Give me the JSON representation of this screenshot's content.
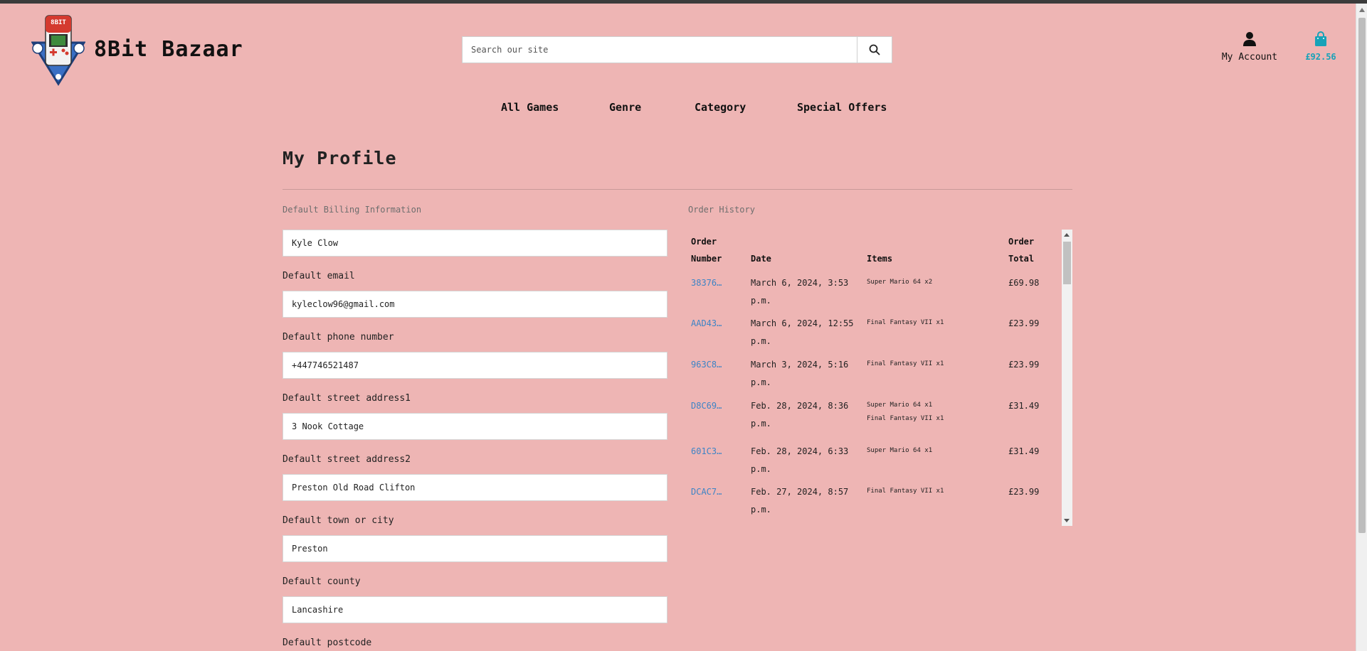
{
  "header": {
    "brand": "8Bit Bazaar",
    "logo_text": "8BIT",
    "search_placeholder": "Search our site",
    "account_label": "My Account",
    "cart_total": "£92.56"
  },
  "nav": [
    "All Games",
    "Genre",
    "Category",
    "Special Offers"
  ],
  "page_title": "My Profile",
  "billing": {
    "title": "Default Billing Information",
    "full_name": "Kyle Clow",
    "fields": [
      {
        "label": "Default email",
        "value": "kyleclow96@gmail.com"
      },
      {
        "label": "Default phone number",
        "value": "+447746521487"
      },
      {
        "label": "Default street address1",
        "value": "3 Nook Cottage"
      },
      {
        "label": "Default street address2",
        "value": "Preston Old Road Clifton"
      },
      {
        "label": "Default town or city",
        "value": "Preston"
      },
      {
        "label": "Default county",
        "value": "Lancashire"
      },
      {
        "label": "Default postcode",
        "value": ""
      }
    ]
  },
  "orders": {
    "title": "Order History",
    "headers": {
      "number_1": "Order",
      "number_2": "Number",
      "date": "Date",
      "items": "Items",
      "total_1": "Order",
      "total_2": "Total"
    },
    "rows": [
      {
        "number": "38376…",
        "date_1": "March 6, 2024, 3:53",
        "date_2": "p.m.",
        "items": [
          "Super Mario 64 x2"
        ],
        "total": "£69.98"
      },
      {
        "number": "AAD43…",
        "date_1": "March 6, 2024, 12:55",
        "date_2": "p.m.",
        "items": [
          "Final Fantasy VII x1"
        ],
        "total": "£23.99"
      },
      {
        "number": "963C8…",
        "date_1": "March 3, 2024, 5:16",
        "date_2": "p.m.",
        "items": [
          "Final Fantasy VII x1"
        ],
        "total": "£23.99"
      },
      {
        "number": "D8C69…",
        "date_1": "Feb. 28, 2024, 8:36",
        "date_2": "p.m.",
        "items": [
          "Super Mario 64 x1",
          "Final Fantasy VII x1"
        ],
        "total": "£31.49"
      },
      {
        "number": "601C3…",
        "date_1": "Feb. 28, 2024, 6:33",
        "date_2": "p.m.",
        "items": [
          "Super Mario 64 x1"
        ],
        "total": "£31.49"
      },
      {
        "number": "DCAC7…",
        "date_1": "Feb. 27, 2024, 8:57",
        "date_2": "p.m.",
        "items": [
          "Final Fantasy VII x1"
        ],
        "total": "£23.99"
      }
    ]
  }
}
